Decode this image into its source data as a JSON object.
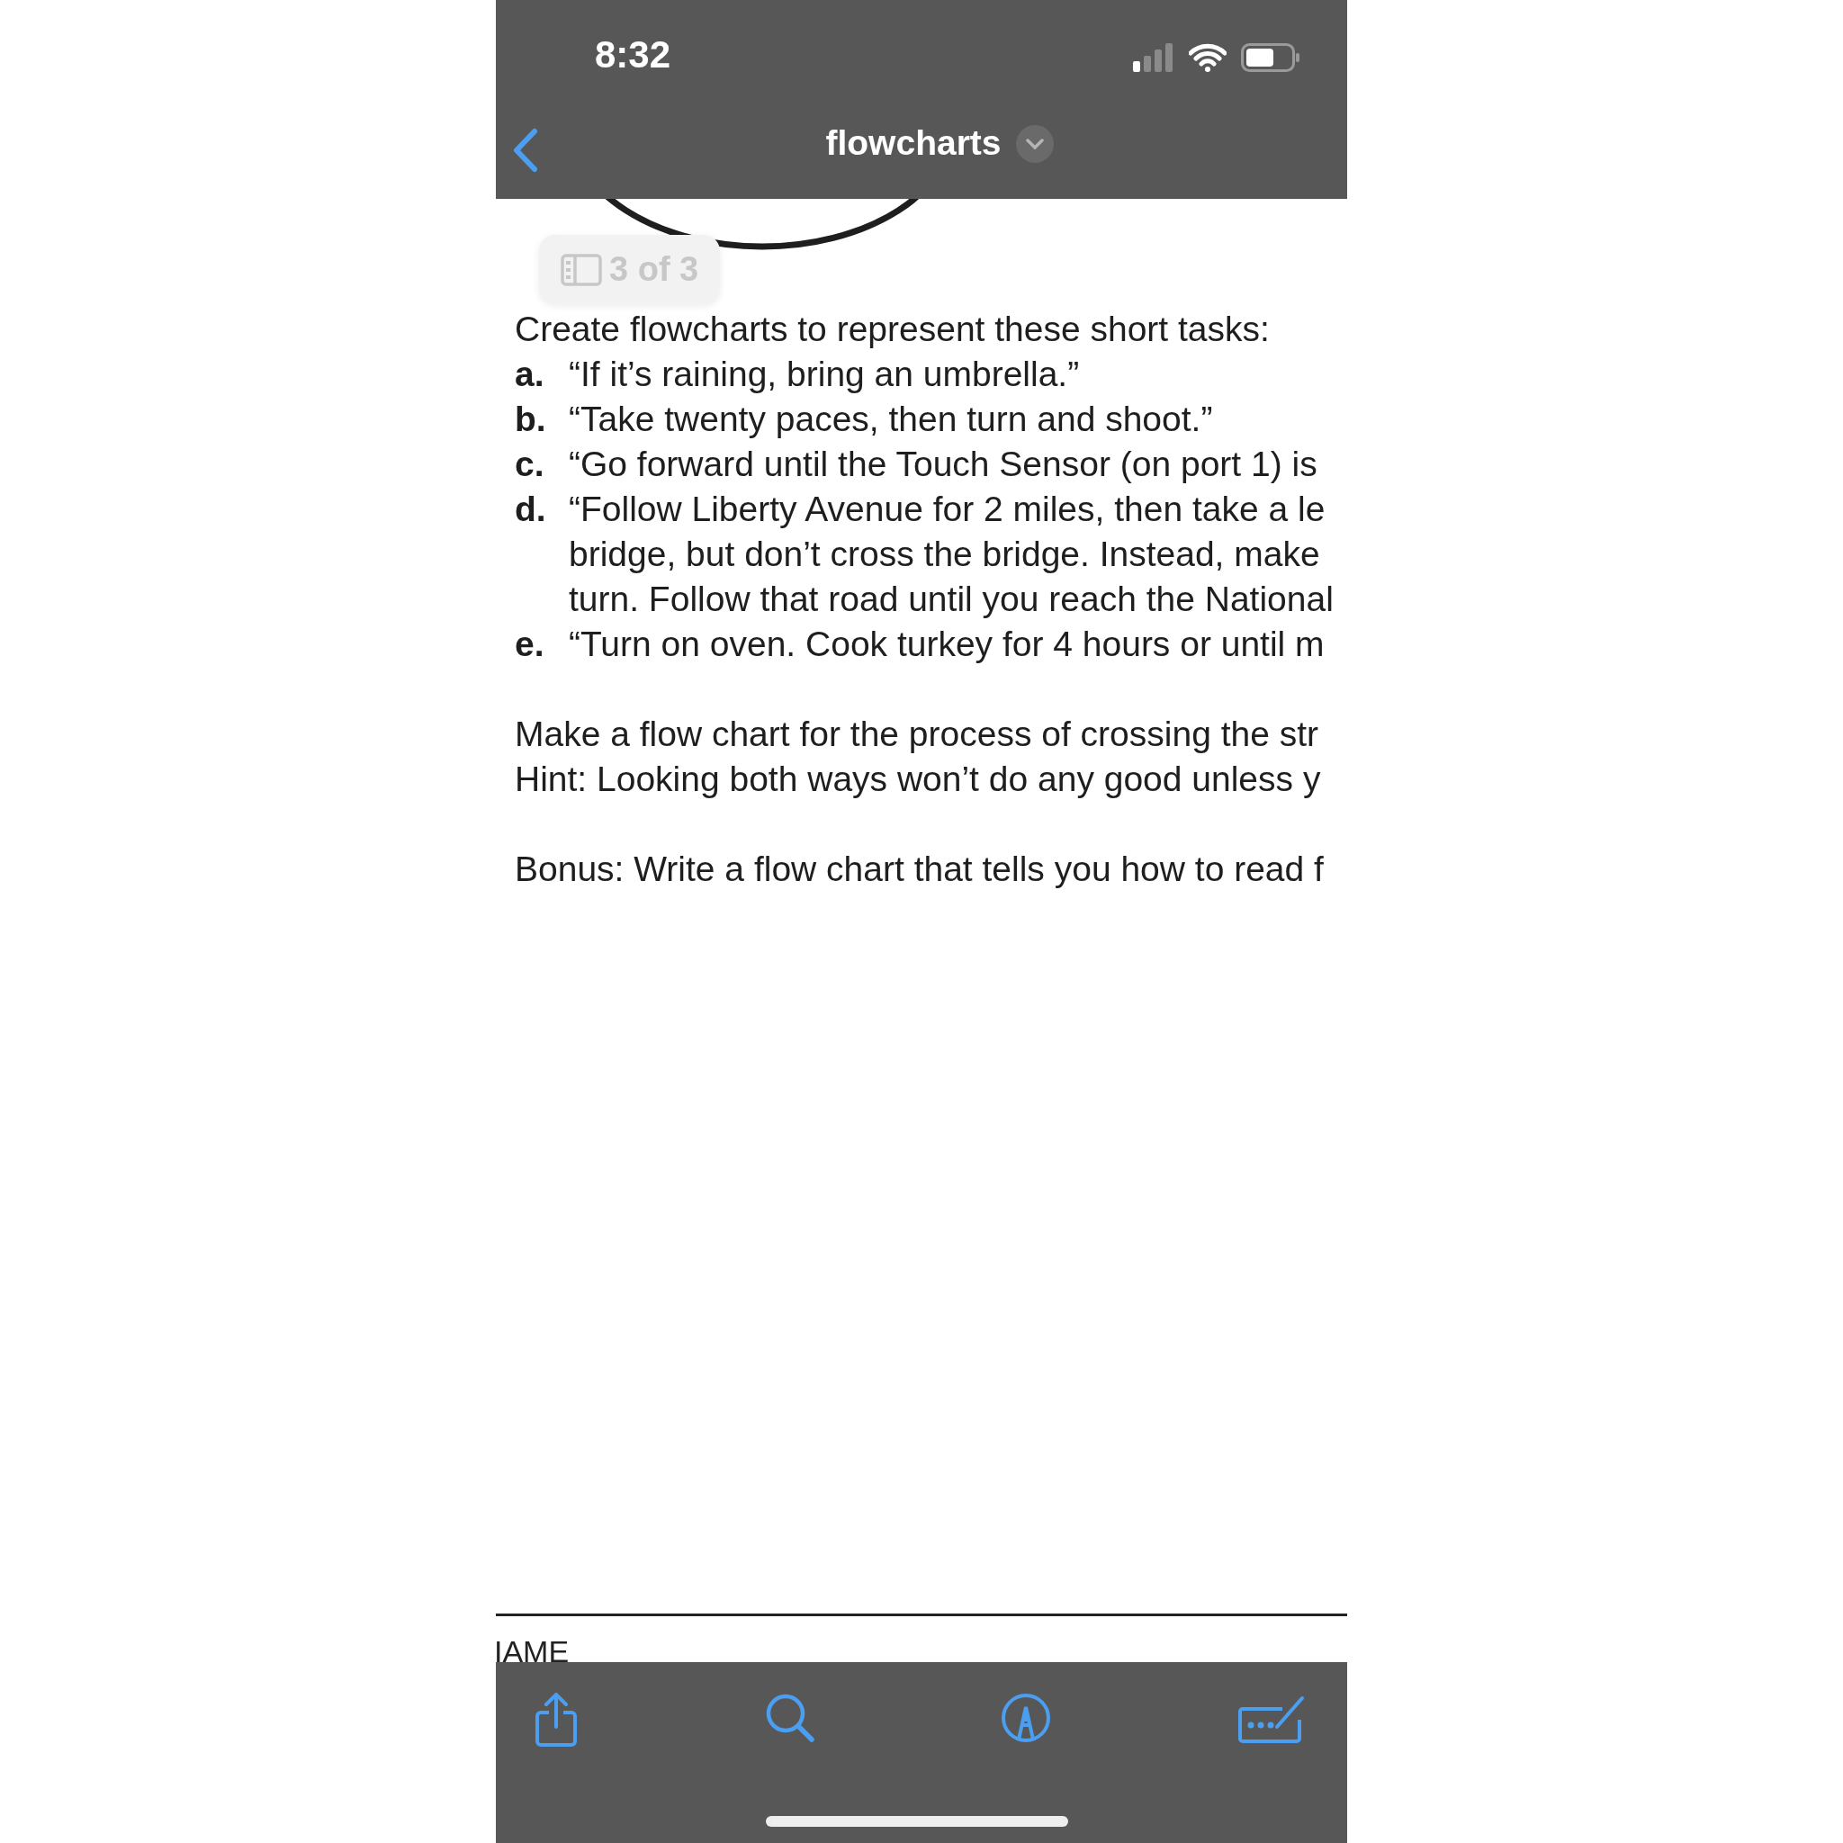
{
  "status_bar": {
    "time": "8:32"
  },
  "nav": {
    "title": "flowcharts"
  },
  "page_indicator": {
    "text": "3 of 3"
  },
  "document": {
    "intro": "Create flowcharts to represent these short tasks:",
    "tasks": [
      {
        "marker": "a.",
        "lines": [
          "“If it’s raining, bring an umbrella.”"
        ]
      },
      {
        "marker": "b.",
        "lines": [
          "“Take twenty paces, then turn and shoot.”"
        ]
      },
      {
        "marker": "c.",
        "lines": [
          "“Go forward until the Touch Sensor (on port 1) is"
        ]
      },
      {
        "marker": "d.",
        "lines": [
          "“Follow Liberty Avenue for 2 miles, then take a le",
          "bridge, but don’t cross the bridge. Instead, make",
          "turn. Follow that road until you reach the National"
        ]
      },
      {
        "marker": "e.",
        "lines": [
          "“Turn on oven. Cook turkey for 4 hours or until m"
        ]
      }
    ],
    "paragraphs": [
      [
        "Make a flow chart for the process of crossing the str",
        "Hint: Looking both ways won’t do any good unless y"
      ],
      [
        "Bonus: Write a flow chart that tells you how to read f"
      ]
    ],
    "footer_label": "IAME"
  }
}
